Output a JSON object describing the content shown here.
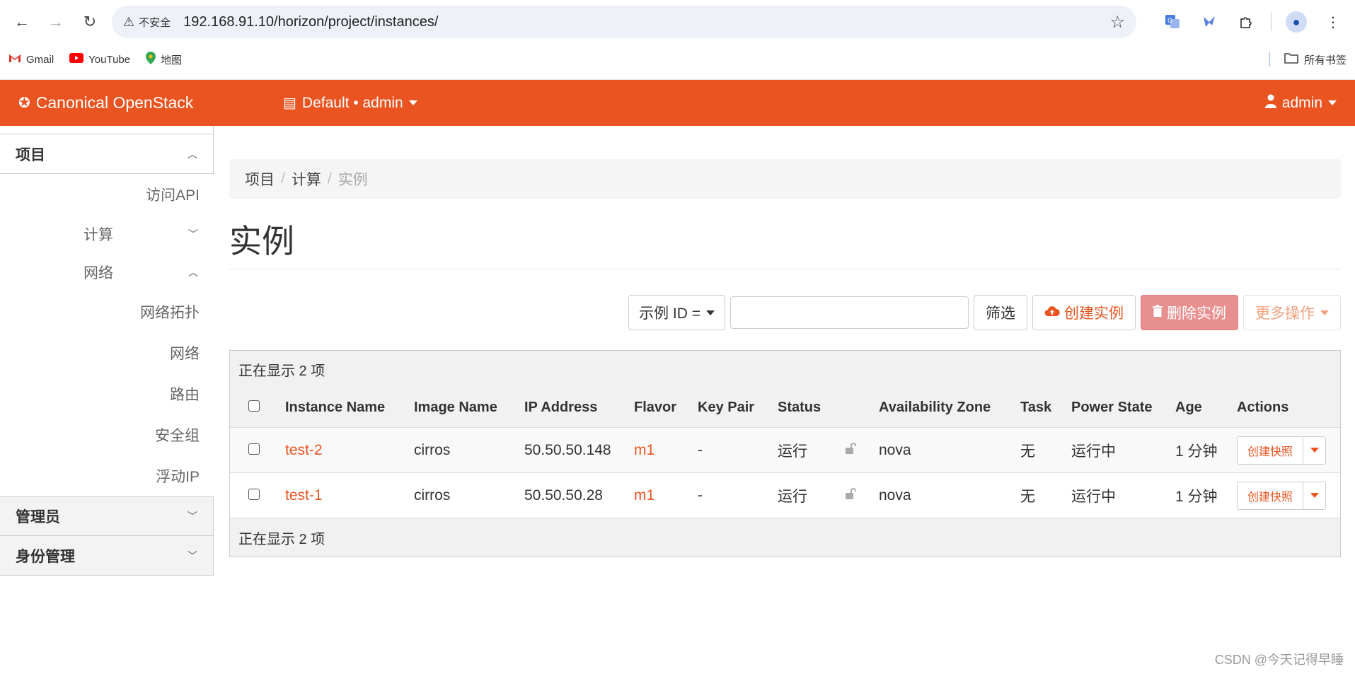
{
  "browser": {
    "back_icon": "←",
    "forward_icon": "→",
    "reload_icon": "↻",
    "security_label": "不安全",
    "url": "192.168.91.10/horizon/project/instances/",
    "bookmarks": [
      {
        "label": "Gmail"
      },
      {
        "label": "YouTube"
      },
      {
        "label": "地图"
      }
    ],
    "all_bookmarks": "所有书签"
  },
  "header": {
    "brand": "Canonical OpenStack",
    "project": "Default • admin",
    "user": "admin",
    "accent": "#e95420"
  },
  "sidebar": {
    "project": "项目",
    "access_api": "访问API",
    "compute": "计算",
    "network": "网络",
    "network_items": [
      "网络拓扑",
      "网络",
      "路由",
      "安全组",
      "浮动IP"
    ],
    "admin": "管理员",
    "identity": "身份管理"
  },
  "breadcrumb": {
    "project": "项目",
    "compute": "计算",
    "current": "实例"
  },
  "page": {
    "title": "实例"
  },
  "toolbar": {
    "filter_field": "示例 ID =",
    "filter_button": "筛选",
    "create": "创建实例",
    "delete": "删除实例",
    "more": "更多操作"
  },
  "table": {
    "info": "正在显示 2 项",
    "headers": {
      "name": "Instance Name",
      "image": "Image Name",
      "ip": "IP Address",
      "flavor": "Flavor",
      "keypair": "Key Pair",
      "status": "Status",
      "az": "Availability Zone",
      "task": "Task",
      "power": "Power State",
      "age": "Age",
      "actions": "Actions"
    },
    "rows": [
      {
        "name": "test-2",
        "image": "cirros",
        "ip": "50.50.50.148",
        "flavor": "m1",
        "keypair": "-",
        "status": "运行",
        "az": "nova",
        "task": "无",
        "power": "运行中",
        "age": "1 分钟",
        "action": "创建快照"
      },
      {
        "name": "test-1",
        "image": "cirros",
        "ip": "50.50.50.28",
        "flavor": "m1",
        "keypair": "-",
        "status": "运行",
        "az": "nova",
        "task": "无",
        "power": "运行中",
        "age": "1 分钟",
        "action": "创建快照"
      }
    ],
    "footer": "正在显示 2 项"
  },
  "watermark": "CSDN @今天记得早睡"
}
